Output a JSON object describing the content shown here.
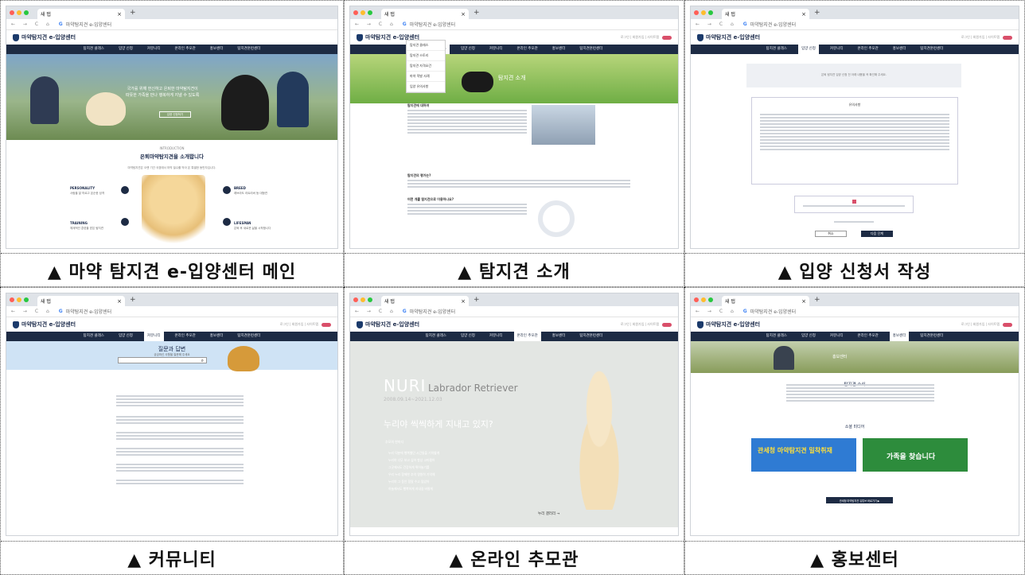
{
  "browser": {
    "tab_title": "새 탭",
    "close": "×",
    "new_tab": "+",
    "nav": "← → C ⌂",
    "google": "G",
    "address": "마약탐지견 e-입양센터"
  },
  "site": {
    "logo": "마약탐지견 e-입양센터",
    "util": "로그인 | 회원가입 | 사이트맵",
    "menu": [
      "탐지견 클래스",
      "입양 신청",
      "커뮤니티",
      "온라인 추모관",
      "홍보센터",
      "탐지견훈련센터"
    ]
  },
  "panels": {
    "p1": {
      "caption": "▲ 마약 탐지견 e-입양센터 메인",
      "hero_line1": "국가를 위해 헌신하고 은퇴한 마약탐지견이",
      "hero_line2": "따뜻한 가족을 만나 행복하게 지낼 수 있도록",
      "hero_btn": "입양 신청하기",
      "intro_small": "INTRODUCTION",
      "intro_title": "은퇴마약탐지견을 소개합니다",
      "intro_desc": "마약탐지견은 오랜 기간 국경에서 마약 밀수를 막아 온 특별한 동반자입니다.",
      "features": [
        {
          "title": "PERSONALITY",
          "desc": "사람을 잘 따르고 온순한 성격"
        },
        {
          "title": "BREED",
          "desc": "래브라도 리트리버 등 대형견"
        },
        {
          "title": "TRAINING",
          "desc": "체계적인 훈련을 받은 탐지견"
        },
        {
          "title": "LIFESPAN",
          "desc": "은퇴 후 새로운 삶을 시작합니다"
        }
      ]
    },
    "p2": {
      "caption": "▲ 탐지견 소개",
      "hero_title": "탐지견 소개",
      "submenu": [
        "탐지견 클래스",
        "탐지견 스토리",
        "탐지견 자격요건",
        "마약 적발 사례",
        "입양 유의사항"
      ],
      "sec1": "탐지견에 대하여",
      "sec2": "탐지견의 평가는?",
      "sec3": "어떤 개를 탐지견으로 이용하나요?"
    },
    "p3": {
      "caption": "▲ 입양 신청서 작성",
      "notice": "은퇴 탐지견 입양 신청 전 아래 내용을 꼭 확인해 주세요.",
      "agree_title": "유의사항",
      "cancel": "취소",
      "submit": "다음 단계"
    },
    "p4": {
      "caption": "▲ 커뮤니티",
      "hero_title": "질문과 답변",
      "hero_sub": "궁금하신 사항을 질문해 주세요",
      "search_btn": "⌕"
    },
    "p5": {
      "caption": "▲ 온라인 추모관",
      "nuri": "NURI",
      "breed": "Labrador Retriever",
      "dates": "2008.09.14~2021.12.03",
      "message": "누리야 씩씩하게 지내고 있지?",
      "letter": "추모의 한마디",
      "lines": [
        "누리 덕분에 행복했던 시간들을 기억할게",
        "누리야 너무 보고 싶어 항상 고마웠어",
        "그곳에서도 건강하게 뛰어놀기를",
        "우리 누리 함께한 추억 영원히 기억해",
        "누리야 그 동안 정말 수고 많았어",
        "하늘에서도 행복하게 지내길 바랄게"
      ],
      "link": "누리 갤러리 →"
    },
    "p6": {
      "caption": "▲ 홍보센터",
      "hero_title": "홍보센터",
      "news_title": "탐지견 소식",
      "social_title": "소셜 미디어",
      "promo1": "관세청 마약탐지견 밀착취재",
      "promo2": "가족을 찾습니다",
      "more_btn": "관세청 마약탐지견 유튜브 바로가기 ▶"
    }
  },
  "colors": {
    "navy": "#1d2b44",
    "accent": "#d94f6a",
    "grass": "#6fae45"
  }
}
